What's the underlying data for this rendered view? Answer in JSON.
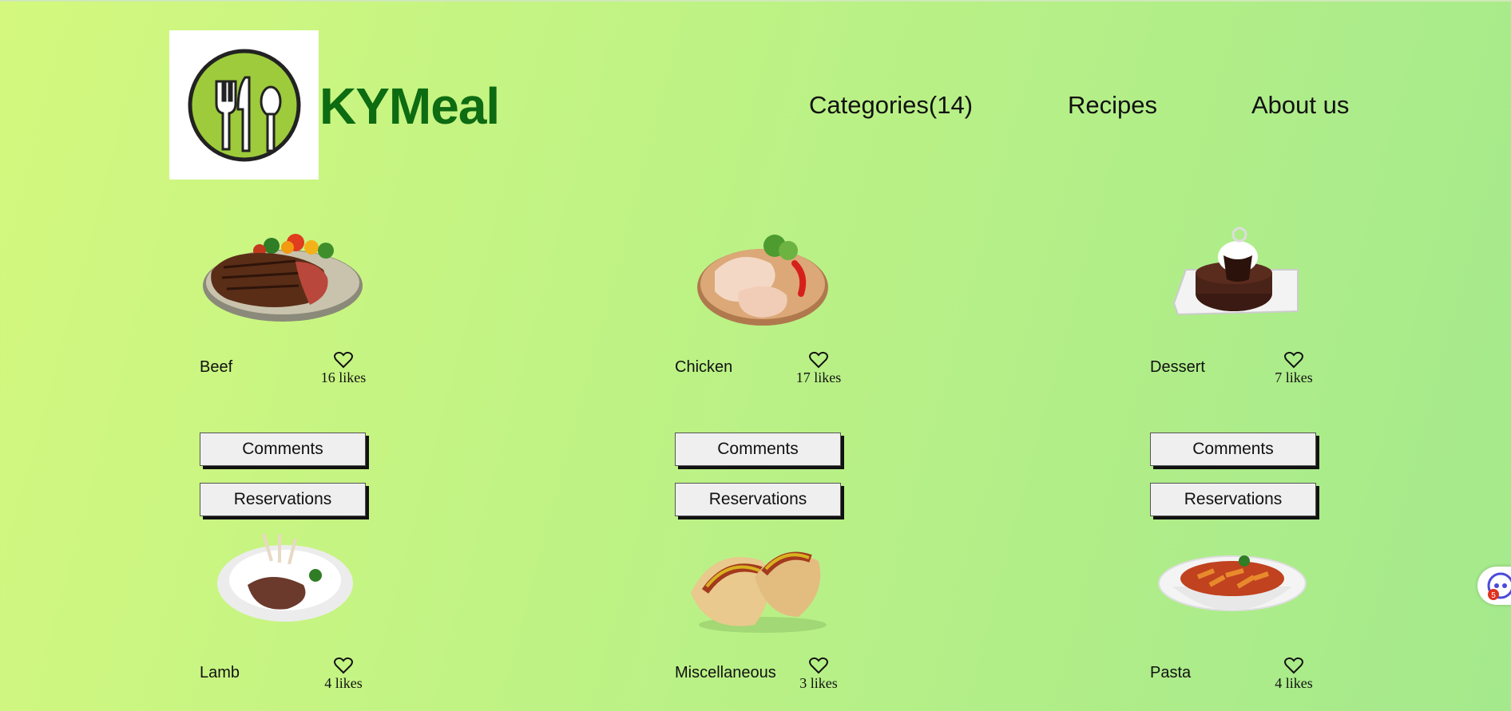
{
  "header": {
    "brand": "KYMeal",
    "nav": [
      {
        "label": "Categories(14)"
      },
      {
        "label": "Recipes"
      },
      {
        "label": "About us"
      }
    ]
  },
  "meals": [
    {
      "name": "Beef",
      "likes": "16 likes",
      "comments_label": "Comments",
      "reservations_label": "Reservations"
    },
    {
      "name": "Chicken",
      "likes": "17 likes",
      "comments_label": "Comments",
      "reservations_label": "Reservations"
    },
    {
      "name": "Dessert",
      "likes": "7 likes",
      "comments_label": "Comments",
      "reservations_label": "Reservations"
    },
    {
      "name": "Lamb",
      "likes": "4 likes"
    },
    {
      "name": "Miscellaneous",
      "likes": "3 likes"
    },
    {
      "name": "Pasta",
      "likes": "4 likes"
    }
  ],
  "widget": {
    "badge": "5"
  },
  "colors": {
    "brand": "#0d6b12",
    "logo_green": "#9dcb3b"
  },
  "icons": [
    "fork-knife-spoon-logo",
    "heart-icon",
    "assistant-icon"
  ]
}
